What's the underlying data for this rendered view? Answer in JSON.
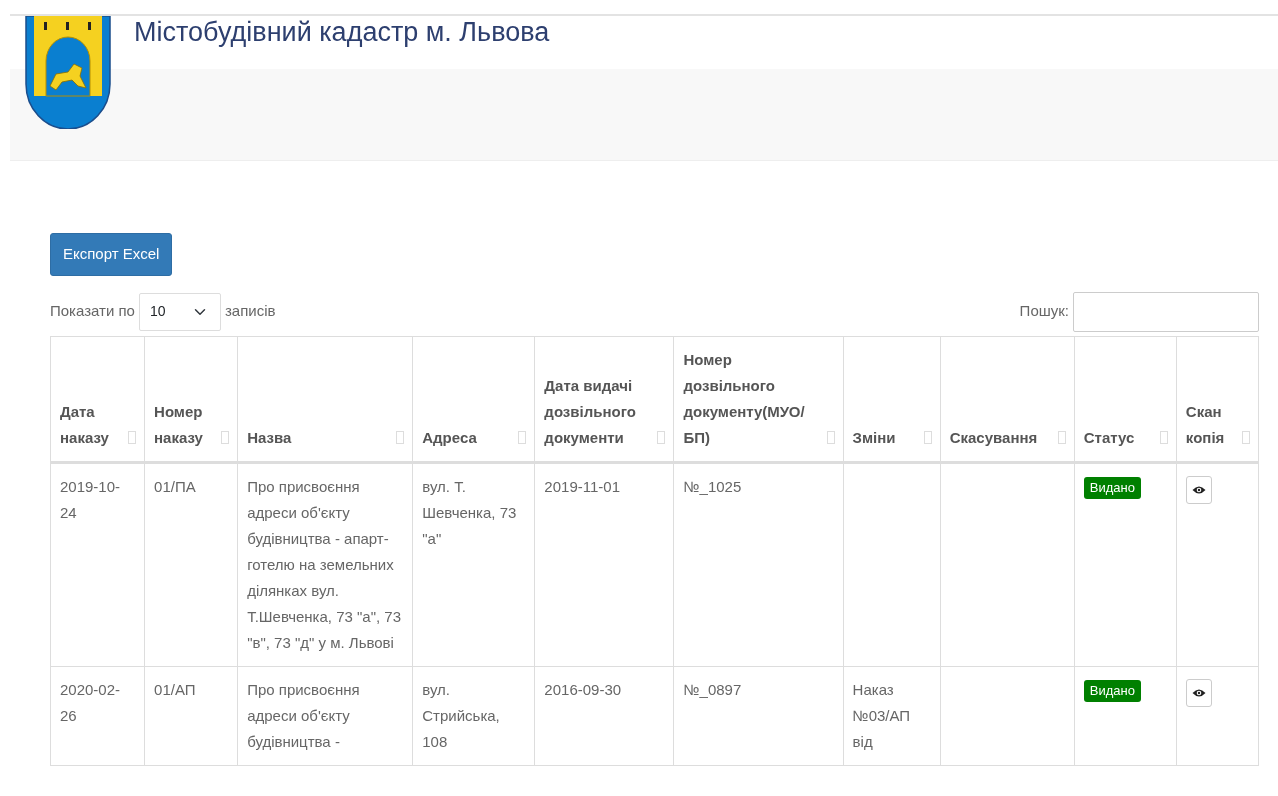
{
  "header": {
    "title": "Містобудівний кадастр м. Львова"
  },
  "toolbar": {
    "export_button": "Експорт Excel",
    "length_label_before": "Показати по",
    "length_value": "10",
    "length_label_after": "записів",
    "search_label": "Пошук:"
  },
  "table": {
    "columns": [
      "Дата наказу",
      "Номер наказу",
      "Назва",
      "Адреса",
      "Дата видачі дозвільного документи",
      "Номер дозвільного документу(МУО/ БП)",
      "Зміни",
      "Скасування",
      "Статус",
      "Скан копія"
    ],
    "rows": [
      {
        "order_date": "2019-10-24",
        "order_number": "01/ПА",
        "name": "Про присвоєння адреси об'єкту будівництва - апарт-готелю на земельних ділянках вул. Т.Шевченка, 73 \"а\", 73 \"в\", 73 \"д\" у м. Львові",
        "address": "вул. Т. Шевченка, 73 \"а\"",
        "permit_date": "2019-11-01",
        "permit_number": "№_1025",
        "status": "Видано"
      },
      {
        "order_date": "2020-02-26",
        "order_number": "01/АП",
        "name": "Про присвоєння адреси об'єкту будівництва -",
        "address": "вул. Стрийська, 108",
        "permit_date": "2016-09-30",
        "permit_number": "№_0897",
        "changes": "Наказ №03/АП від",
        "status": "Видано"
      }
    ]
  }
}
